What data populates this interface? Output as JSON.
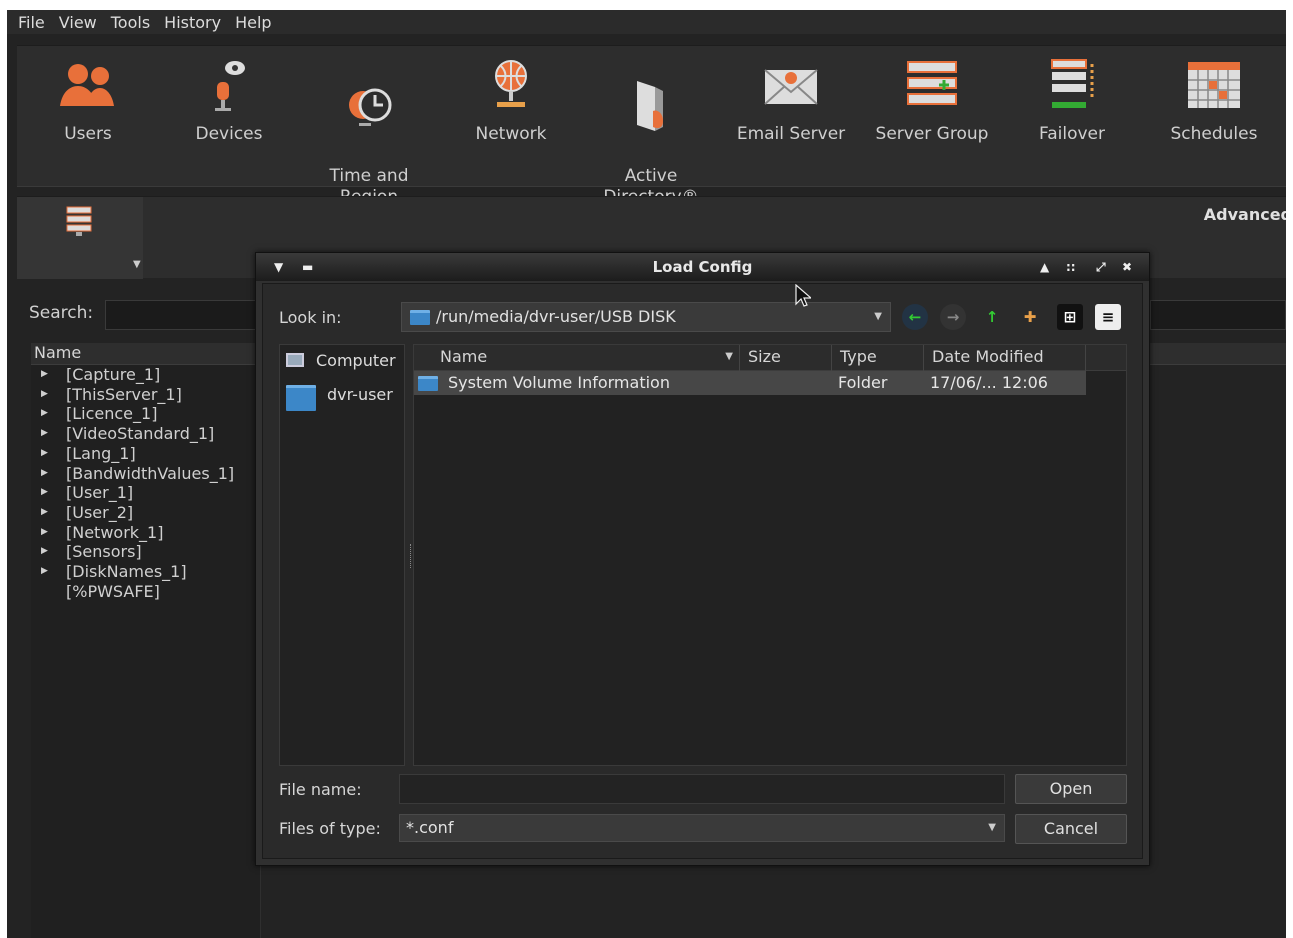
{
  "menu": [
    "File",
    "View",
    "Tools",
    "History",
    "Help"
  ],
  "toolbar": [
    {
      "label": "Users",
      "icon": "users-icon"
    },
    {
      "label": "Devices",
      "icon": "devices-icon"
    },
    {
      "label": "Time and\nRegion",
      "icon": "time-region-icon"
    },
    {
      "label": "Network",
      "icon": "network-icon"
    },
    {
      "label": "Active\nDirectory®",
      "icon": "active-directory-icon"
    },
    {
      "label": "Email Server",
      "icon": "email-icon"
    },
    {
      "label": "Server Group",
      "icon": "server-group-icon"
    },
    {
      "label": "Failover",
      "icon": "failover-icon"
    },
    {
      "label": "Schedules",
      "icon": "schedules-icon"
    }
  ],
  "panel": {
    "advanced_label": "Advanced"
  },
  "search": {
    "label": "Search:"
  },
  "tree": {
    "header": "Name",
    "nodes": [
      "[Capture_1]",
      "[ThisServer_1]",
      "[Licence_1]",
      "[VideoStandard_1]",
      "[Lang_1]",
      "[BandwidthValues_1]",
      "[User_1]",
      "[User_2]",
      "[Network_1]",
      "[Sensors]",
      "[DiskNames_1]",
      "[%PWSAFE]"
    ]
  },
  "dialog": {
    "title": "Load Config",
    "look_in_label": "Look in:",
    "look_in_value": "/run/media/dvr-user/USB DISK",
    "places": [
      "Computer",
      "dvr-user"
    ],
    "columns": [
      "Name",
      "Size",
      "Type",
      "Date Modified"
    ],
    "rows": [
      {
        "name": "System Volume Information",
        "size": "",
        "type": "Folder",
        "modified": "17/06/... 12:06"
      }
    ],
    "file_name_label": "File name:",
    "file_name_value": "",
    "files_of_type_label": "Files of type:",
    "files_of_type_value": "*.conf",
    "open_label": "Open",
    "cancel_label": "Cancel"
  }
}
